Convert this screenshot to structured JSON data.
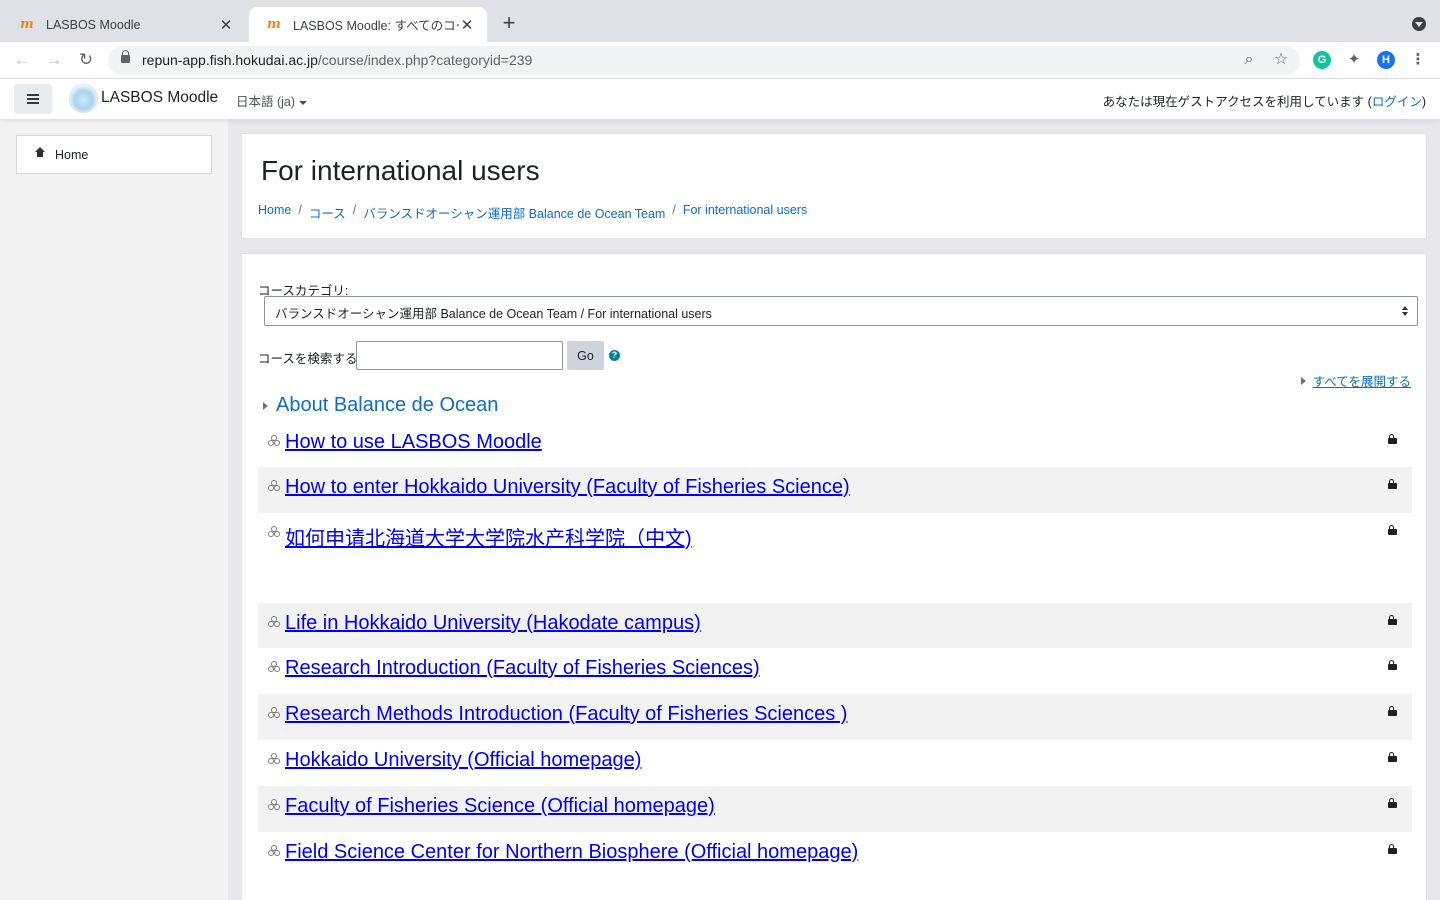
{
  "browser": {
    "tabs": [
      {
        "title": "LASBOS Moodle",
        "active": false
      },
      {
        "title": "LASBOS Moodle: すべてのコース",
        "active": true
      }
    ],
    "url_host": "repun-app.fish.hokudai.ac.jp",
    "url_path": "/course/index.php?categoryid=239",
    "profile_initial": "H",
    "grammarly_initial": "G"
  },
  "navbar": {
    "brand": "LASBOS Moodle",
    "language": "日本語 (ja)",
    "guest_text": "あなたは現在ゲストアクセスを利用しています (",
    "login_link": "ログイン",
    "guest_suffix": ")"
  },
  "sidebar": {
    "home_label": "Home"
  },
  "header": {
    "title": "For international users",
    "breadcrumb": [
      "Home",
      "コース",
      "バランスドオーシャン運用部 Balance de Ocean Team",
      "For international users"
    ]
  },
  "main": {
    "category_label": "コースカテゴリ:",
    "category_selected": "バランスドオーシャン運用部 Balance de Ocean Team / For international users",
    "search_label": "コースを検索する",
    "search_value": "",
    "go_label": "Go",
    "help_glyph": "?",
    "expand_all": "すべてを展開する",
    "subcategory": "About Balance de Ocean",
    "courses": [
      {
        "name": "How to use LASBOS Moodle",
        "height": 45
      },
      {
        "name": "How to enter Hokkaido University (Faculty of Fisheries Science)",
        "height": 46
      },
      {
        "name": "如何申请北海道大学大学院水产科学院（中文)",
        "height": 90
      },
      {
        "name": "Life in Hokkaido University (Hakodate campus)",
        "height": 45
      },
      {
        "name": "Research Introduction (Faculty of Fisheries Sciences)",
        "height": 46
      },
      {
        "name": "Research Methods Introduction (Faculty of Fisheries Sciences )",
        "height": 46
      },
      {
        "name": "Hokkaido University (Official homepage)",
        "height": 46
      },
      {
        "name": "Faculty of Fisheries Science (Official homepage)",
        "height": 46
      },
      {
        "name": "Field Science Center for Northern Biosphere (Official homepage)",
        "height": 46
      }
    ]
  }
}
